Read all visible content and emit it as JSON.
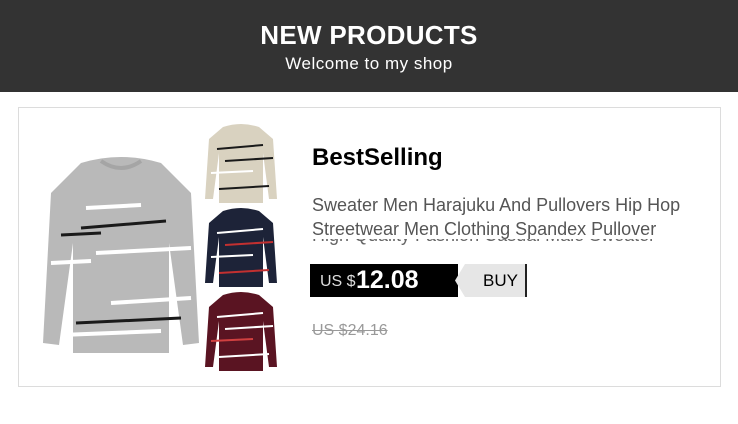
{
  "banner": {
    "title": "NEW PRODUCTS",
    "subtitle": "Welcome to my shop"
  },
  "product": {
    "heading": "BestSelling",
    "description": "Sweater Men Harajuku And Pullovers Hip Hop Streetwear Men Clothing Spandex Pullover",
    "description_cut": "High Quality Fashion Casual Male Sweater",
    "price_currency": "US $",
    "price_value": "12.08",
    "buy_label": "BUY",
    "original_price": "US $24.16",
    "colors": {
      "gray": "#b9b9b9",
      "beige": "#d9d2c0",
      "navy": "#1d2338",
      "burgundy": "#5a1422"
    }
  }
}
